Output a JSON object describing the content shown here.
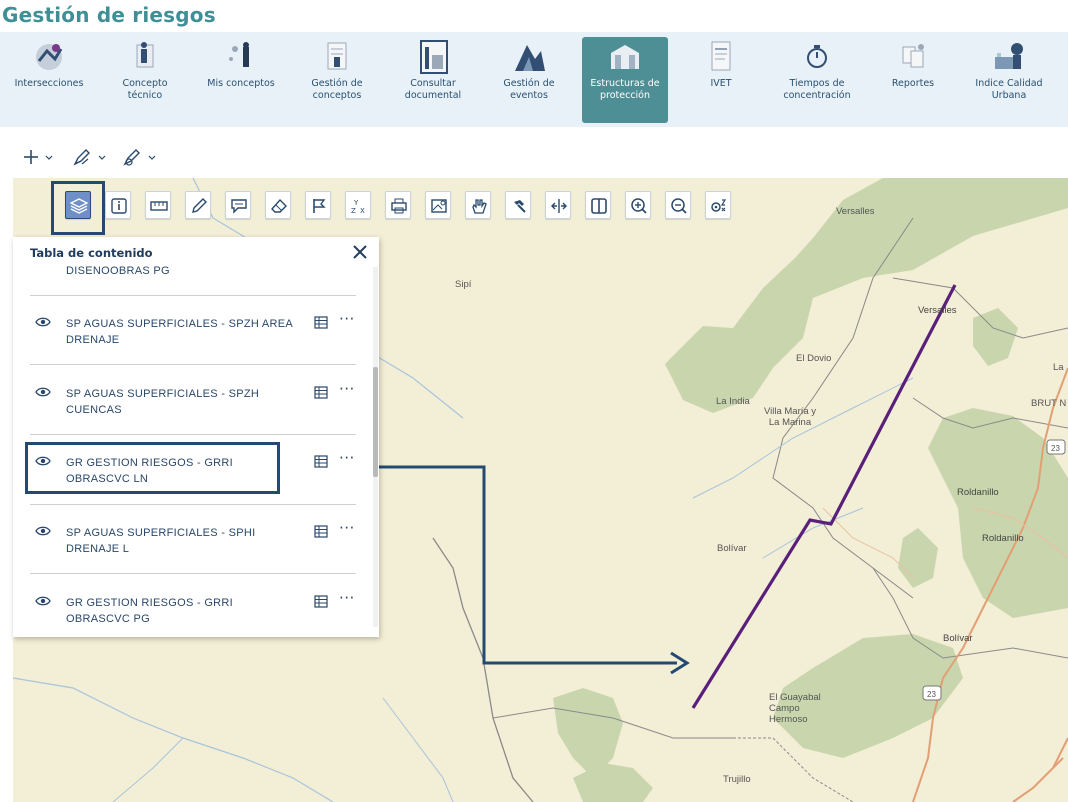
{
  "page_title": "Gestión de riesgos",
  "nav": {
    "items": [
      {
        "label": "Intersecciones",
        "icon": "intersections-icon",
        "active": false
      },
      {
        "label": "Concepto técnico",
        "icon": "technical-concept-icon",
        "active": false
      },
      {
        "label": "Mis conceptos",
        "icon": "my-concepts-icon",
        "active": false
      },
      {
        "label": "Gestión de conceptos",
        "icon": "concept-management-icon",
        "active": false
      },
      {
        "label": "Consultar documental",
        "icon": "document-search-icon",
        "active": false
      },
      {
        "label": "Gestión de eventos",
        "icon": "event-management-icon",
        "active": false
      },
      {
        "label": "Estructuras de protección",
        "icon": "protection-structures-icon",
        "active": true
      },
      {
        "label": "IVET",
        "icon": "ivet-icon",
        "active": false
      },
      {
        "label": "Tiempos de concentración",
        "icon": "concentration-time-icon",
        "active": false
      },
      {
        "label": "Reportes",
        "icon": "reports-icon",
        "active": false
      },
      {
        "label": "Indice Calidad Urbana",
        "icon": "urban-quality-icon",
        "active": false
      }
    ]
  },
  "edit_tools": [
    "add-icon",
    "draw-edit-icon",
    "attribute-edit-icon"
  ],
  "map_toolbar": {
    "tools": [
      {
        "name": "layers-tool",
        "icon": "layers-icon",
        "active": true
      },
      {
        "name": "info-tool",
        "icon": "info-icon",
        "active": false
      },
      {
        "name": "measure-tool",
        "icon": "ruler-icon",
        "active": false
      },
      {
        "name": "draw-tool",
        "icon": "pencil-icon",
        "active": false
      },
      {
        "name": "comment-tool",
        "icon": "speech-bubble-icon",
        "active": false
      },
      {
        "name": "erase-tool",
        "icon": "eraser-icon",
        "active": false
      },
      {
        "name": "flag-tool",
        "icon": "flag-icon",
        "active": false
      },
      {
        "name": "coordinates-tool",
        "icon": "xy-coordinates-icon",
        "active": false
      },
      {
        "name": "print-tool",
        "icon": "print-icon",
        "active": false
      },
      {
        "name": "map-image-tool",
        "icon": "map-image-icon",
        "active": false
      },
      {
        "name": "pan-tool",
        "icon": "hand-icon",
        "active": false
      },
      {
        "name": "hammer-tool",
        "icon": "hammer-icon",
        "active": false
      },
      {
        "name": "split-tool",
        "icon": "split-arrows-icon",
        "active": false
      },
      {
        "name": "swipe-tool",
        "icon": "swipe-panel-icon",
        "active": false
      },
      {
        "name": "zoom-in-tool",
        "icon": "zoom-in-icon",
        "active": false
      },
      {
        "name": "zoom-out-tool",
        "icon": "zoom-out-icon",
        "active": false
      },
      {
        "name": "zoom-settings-tool",
        "icon": "zoom-settings-icon",
        "active": false
      }
    ]
  },
  "toc": {
    "title": "Tabla de contenido",
    "partial_item": "DISENOOBRAS PG",
    "items": [
      {
        "name": "SP AGUAS SUPERFICIALES - SPZH AREA DRENAJE"
      },
      {
        "name": "SP AGUAS SUPERFICIALES - SPZH CUENCAS"
      },
      {
        "name": "GR GESTION RIESGOS - GRRI OBRASCVC LN",
        "highlighted": true
      },
      {
        "name": "SP AGUAS SUPERFICIALES - SPHI DRENAJE L"
      },
      {
        "name": "GR GESTION RIESGOS - GRRI OBRASCVC PG"
      }
    ],
    "more_label": "···"
  },
  "map": {
    "places": [
      "Versalles",
      "Sipí",
      "Versalles",
      "El Dovio",
      "La India",
      "Villa María y La Marina",
      "BRUT N",
      "La",
      "Roldanillo",
      "Roldanillo",
      "Bolívar",
      "Bolívar",
      "El Guayabal Campo Hermoso",
      "Trujillo"
    ],
    "road_shields": [
      "23",
      "23"
    ]
  },
  "colors": {
    "accent": "#4d8f95",
    "title": "#3f8f97",
    "nav_bg": "#e8f1f8",
    "highlight": "#244a72",
    "map_bg": "#f3eed6",
    "forest": "#c9d6ad",
    "route": "#5a1f7a"
  }
}
